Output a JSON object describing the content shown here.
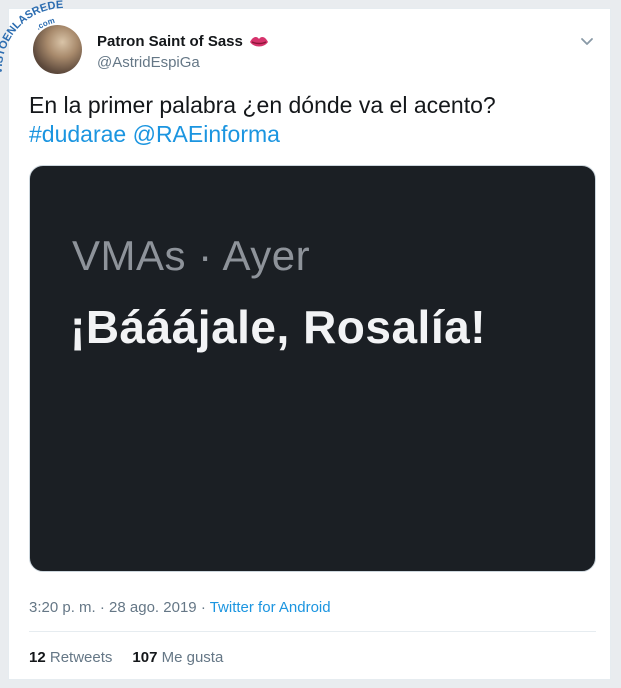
{
  "watermark": {
    "text": "VISTOENLASREDES",
    "suffix": ".com"
  },
  "tweet": {
    "author": {
      "display_name": "Patron Saint of Sass",
      "name_emoji": "lips-emoji",
      "handle": "@AstridEspiGa"
    },
    "text": {
      "line1": "En la primer palabra ¿en dónde va el acento?",
      "hashtag": "#dudarae",
      "mention": "@RAEinforma"
    },
    "media": {
      "subtitle": "VMAs · Ayer",
      "headline": "¡Bááájale, Rosalía!"
    },
    "meta": {
      "time": "3:20 p. m.",
      "date": "28 ago. 2019",
      "separator": "·",
      "source": "Twitter for Android"
    },
    "stats": {
      "retweets_count": "12",
      "retweets_label": "Retweets",
      "likes_count": "107",
      "likes_label": "Me gusta"
    }
  },
  "colors": {
    "link": "#1b95e0",
    "text": "#14171a",
    "muted": "#657786",
    "media_bg": "#1b1f24",
    "watermark": "#2b6cb0"
  }
}
